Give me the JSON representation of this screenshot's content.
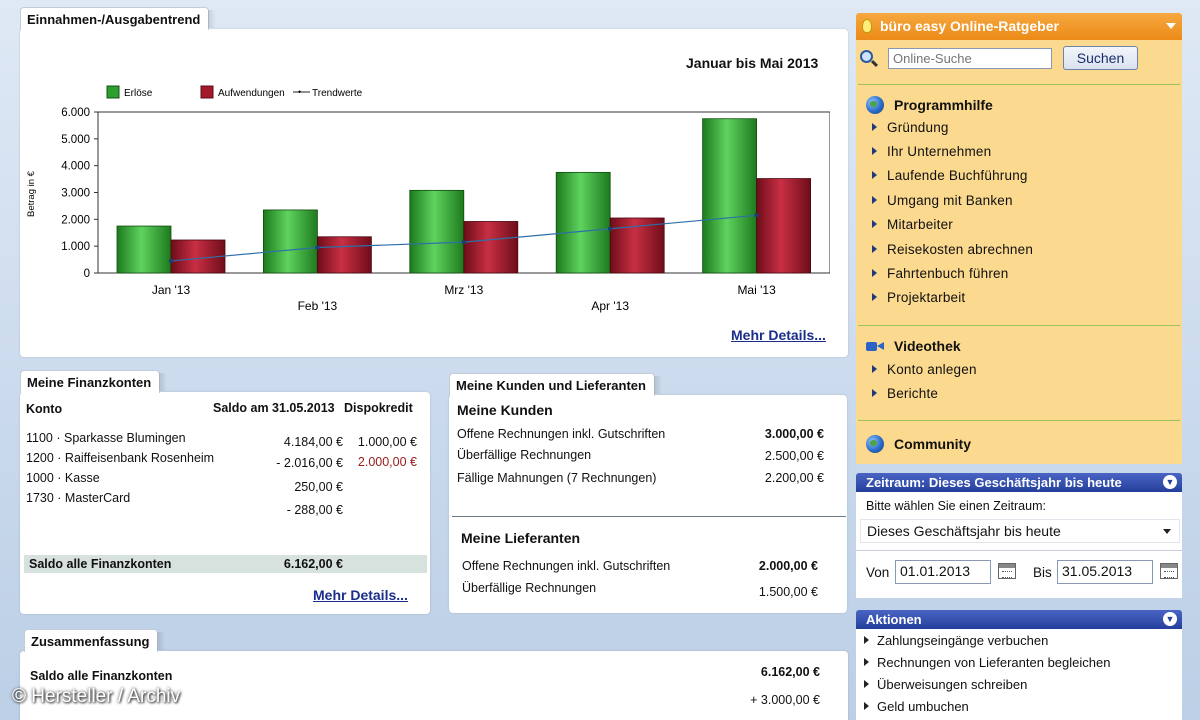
{
  "trend": {
    "tab": "Einnahmen-/Ausgabentrend",
    "period": "Januar bis Mai 2013",
    "details_link": "Mehr Details..."
  },
  "chart_data": {
    "type": "bar",
    "categories": [
      "Jan '13",
      "Feb '13",
      "Mrz '13",
      "Apr '13",
      "Mai '13"
    ],
    "series": [
      {
        "name": "Erlöse",
        "values": [
          1750,
          2350,
          3080,
          3750,
          5750
        ],
        "color": "#2ca02c"
      },
      {
        "name": "Aufwendungen",
        "values": [
          1230,
          1350,
          1920,
          2050,
          3520
        ],
        "color": "#a3182a"
      },
      {
        "name": "Trendwerte",
        "type": "line",
        "values": [
          450,
          950,
          1150,
          1650,
          2150
        ],
        "color": "#2d6fa8"
      }
    ],
    "ylabel": "Betrag in €",
    "yticks": [
      "0",
      "1.000",
      "2.000",
      "3.000",
      "4.000",
      "5.000",
      "6.000"
    ],
    "ylim": [
      0,
      6000
    ],
    "legend": "top-left"
  },
  "finanzkonten": {
    "tab": "Meine Finanzkonten",
    "col_konto": "Konto",
    "col_saldo": "Saldo am 31.05.2013",
    "col_dispo": "Dispokredit",
    "rows": [
      {
        "konto": "1100 · Sparkasse Blumingen",
        "saldo": "4.184,00 €",
        "dispo": "1.000,00 €"
      },
      {
        "konto": "1200 · Raiffeisenbank Rosenheim",
        "saldo": "- 2.016,00 €",
        "dispo": "2.000,00 €"
      },
      {
        "konto": "1000 · Kasse",
        "saldo": "250,00 €",
        "dispo": ""
      },
      {
        "konto": "1730 · MasterCard",
        "saldo": "- 288,00 €",
        "dispo": ""
      }
    ],
    "total_label": "Saldo alle Finanzkonten",
    "total_value": "6.162,00 €",
    "details_link": "Mehr Details..."
  },
  "kunden": {
    "tab": "Meine Kunden und Lieferanten",
    "kunden_title": "Meine Kunden",
    "kunden_rows": [
      {
        "label": "Offene Rechnungen inkl. Gutschriften",
        "value": "3.000,00 €"
      },
      {
        "label": "Überfällige Rechnungen",
        "value": "2.500,00 €"
      },
      {
        "label": "Fällige Mahnungen (7 Rechnungen)",
        "value": "2.200,00 €"
      }
    ],
    "lieferanten_title": "Meine Lieferanten",
    "lieferanten_rows": [
      {
        "label": "Offene Rechnungen inkl. Gutschriften",
        "value": "2.000,00 €"
      },
      {
        "label": "Überfällige Rechnungen",
        "value": "1.500,00 €"
      }
    ]
  },
  "zusammenfassung": {
    "tab": "Zusammenfassung",
    "row1_label": "Saldo alle Finanzkonten",
    "row1_value": "6.162,00 €",
    "row2_value": "+ 3.000,00 €"
  },
  "ratgeber": {
    "title": "büro easy Online-Ratgeber",
    "search_placeholder": "Online-Suche",
    "search_button": "Suchen",
    "programmhilfe": "Programmhilfe",
    "items": [
      "Gründung",
      "Ihr Unternehmen",
      "Laufende Buchführung",
      "Umgang mit Banken",
      "Mitarbeiter",
      "Reisekosten abrechnen",
      "Fahrtenbuch führen",
      "Projektarbeit"
    ],
    "videothek": "Videothek",
    "video_items": [
      "Konto anlegen",
      "Berichte"
    ],
    "community": "Community"
  },
  "zeitraum": {
    "header": "Zeitraum: Dieses Geschäftsjahr bis heute",
    "prompt": "Bitte wählen Sie einen Zeitraum:",
    "selected": "Dieses Geschäftsjahr bis heute",
    "von_label": "Von",
    "von_value": "01.01.2013",
    "bis_label": "Bis",
    "bis_value": "31.05.2013"
  },
  "aktionen": {
    "header": "Aktionen",
    "items": [
      "Zahlungseingänge verbuchen",
      "Rechnungen von Lieferanten begleichen",
      "Überweisungen schreiben",
      "Geld umbuchen"
    ]
  },
  "watermark": "© Hersteller / Archiv"
}
